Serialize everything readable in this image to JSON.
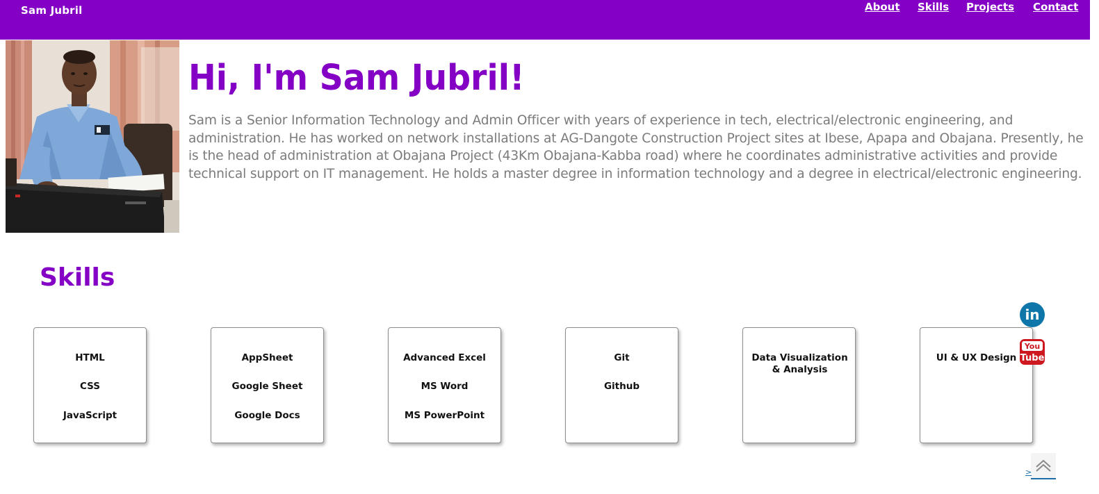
{
  "header": {
    "brand": "Sam Jubril",
    "nav": [
      {
        "label": "About"
      },
      {
        "label": "Skills"
      },
      {
        "label": "Projects"
      },
      {
        "label": "Contact"
      }
    ]
  },
  "hero": {
    "photo_icon": "profile-photo",
    "title": "Hi, I'm Sam Jubril!",
    "bio": "Sam is a Senior Information Technology and Admin Officer with years of experience in tech, electrical/electronic engineering, and administration. He has worked on network installations at AG-Dangote Construction Project sites at Ibese, Apapa and Obajana. Presently, he is the head of administration at Obajana Project (43Km Obajana-Kabba road) where he coordinates administrative activities and provide technical support on IT management. He holds a master degree in information technology and a degree in electrical/electronic engineering."
  },
  "skills": {
    "title": "Skills",
    "cards": [
      {
        "items": [
          "HTML",
          "CSS",
          "JavaScript"
        ]
      },
      {
        "items": [
          "AppSheet",
          "Google Sheet",
          "Google Docs"
        ]
      },
      {
        "items": [
          "Advanced Excel",
          "MS Word",
          "MS PowerPoint"
        ]
      },
      {
        "items": [
          "Git",
          "Github"
        ]
      },
      {
        "items": [
          "Data Visualization & Analysis"
        ]
      },
      {
        "items": [
          "UI & UX Design"
        ]
      }
    ]
  },
  "social": {
    "linkedin_text": "in",
    "youtube_top": "You",
    "youtube_bottom": "Tube"
  },
  "back_to_top": {
    "icon": "chevron-up-icon",
    "link_text": ">"
  },
  "colors": {
    "brand_purple": "#8300c4",
    "body_text": "#7b7b7b",
    "linkedin_blue": "#0e76a8",
    "youtube_red": "#cc181e"
  }
}
